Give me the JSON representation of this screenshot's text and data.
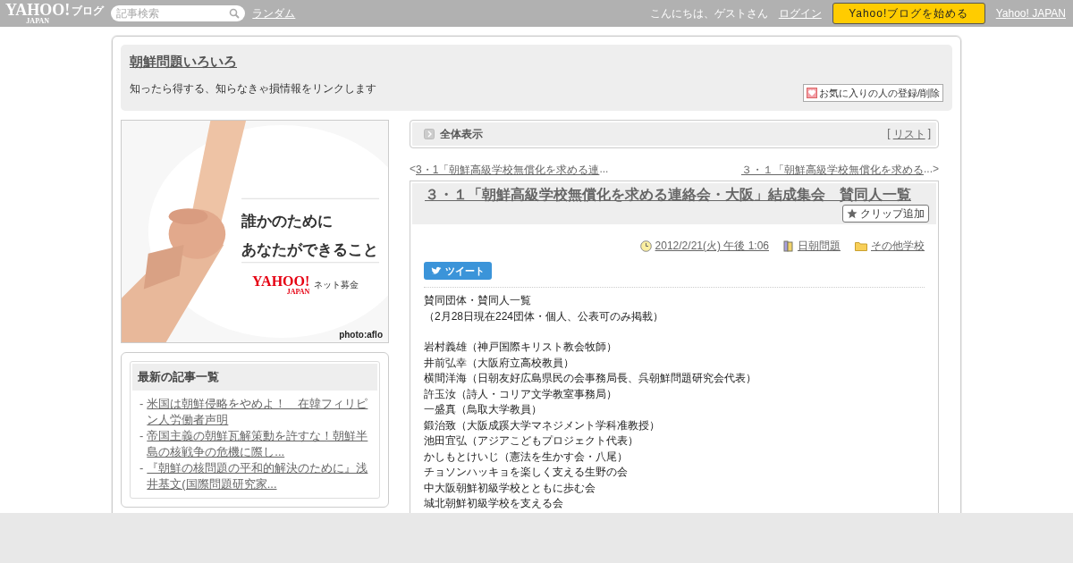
{
  "top_bar": {
    "logo": {
      "main": "YAHOO!",
      "sub": "JAPAN",
      "service": "ブログ"
    },
    "search": {
      "placeholder": "記事検索"
    },
    "random_link": "ランダム",
    "greeting": "こんにちは、ゲストさん",
    "login_link": "ログイン",
    "start_button": "Yahoo!ブログを始める",
    "japan_link": "Yahoo! JAPAN"
  },
  "blog_header": {
    "title": "朝鮮問題いろいろ",
    "description": "知ったら得する、知らなきゃ損情報をリンクします",
    "favorite_button": "お気に入りの人の登録/削除"
  },
  "sidebar": {
    "ad": {
      "kind": "picture",
      "line_1": "誰かのために",
      "line_2": "あなたができること",
      "logo_main": "YAHOO!",
      "logo_sub": "JAPAN",
      "service": "ネット募金",
      "credit": "photo:aflo"
    },
    "recent_articles": {
      "title": "最新の記事一覧",
      "bullet": "-",
      "items": [
        "米国は朝鮮侵略をやめよ！　在韓フィリピン人労働者声明",
        "帝国主義の朝鮮瓦解策動を許すな！朝鮮半島の核戦争の危機に際し...",
        "『朝鮮の核問題の平和的解決のために』浅井基文(国際問題研究家..."
      ]
    }
  },
  "view_bar": {
    "label": "全体表示",
    "open_bracket": "[",
    "list_link": "リスト",
    "close_bracket": "]"
  },
  "pager": {
    "prev_arrow": "<",
    "prev": "3・1「朝鮮高級学校無償化を求める連",
    "prev_ellipsis": "...",
    "next": "３・１「朝鮮高級学校無償化を求める",
    "next_ellipsis": "...",
    "next_arrow": ">"
  },
  "article": {
    "title": "３・１「朝鮮高級学校無償化を求める連絡会・大阪」結成集会　賛同人一覧",
    "clip_button": "クリップ追加",
    "date": "2012/2/21(火) 午後 1:06",
    "category": "日朝問題",
    "folder": "その他学校",
    "tweet_button": "ツイート",
    "intro": [
      "賛同団体・賛同人一覧",
      "（2月28日現在224団体・個人、公表可のみ掲載）"
    ],
    "lines": [
      "岩村義雄（神戸国際キリスト教会牧師）",
      "井前弘幸（大阪府立高校教員）",
      "横間洋海（日朝友好広島県民の会事務局長、呉朝鮮問題研究会代表）",
      "許玉汝（詩人・コリア文学教室事務局）",
      "一盛真（鳥取大学教員）",
      "鍛治致（大阪成蹊大学マネジメント学科准教授）",
      "池田宜弘（アジアこどもプロジェクト代表）",
      "かしもとけいじ（憲法を生かす会・八尾）",
      "チョソンハッキョを楽しく支える生野の会",
      "中大阪朝鮮初級学校とともに歩む会",
      "城北朝鮮初級学校を支える会"
    ]
  }
}
